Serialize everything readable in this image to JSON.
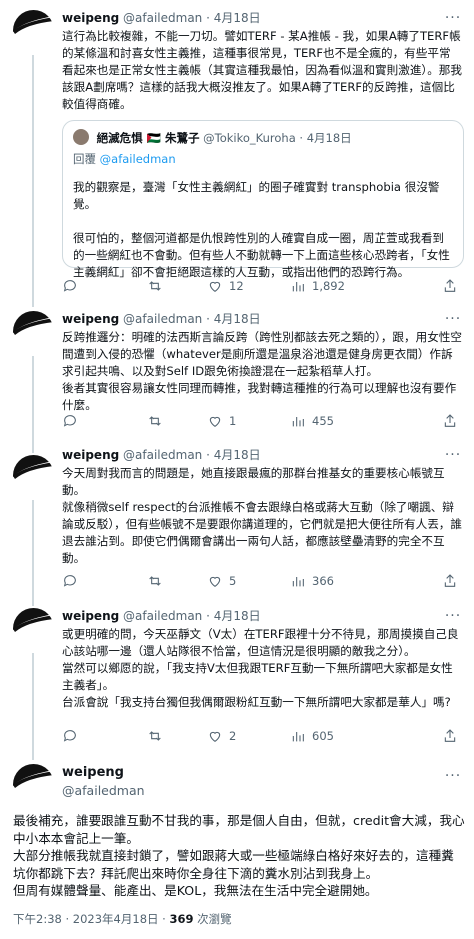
{
  "colors": {
    "text": "#0f1419",
    "secondary": "#536471",
    "border": "#cfd9de",
    "link": "#1d9bf0"
  },
  "author": {
    "name": "weipeng",
    "handle": "@afailedman"
  },
  "tweets": [
    {
      "date": "4月18日",
      "text": "這行為比較複雜，不能一刀切。譬如TERF - 某A推帳 - 我，如果A轉了TERF帳的某條溫和討喜女性主義推，這種事很常見，TERF也不是全瘋的，有些平常看起來也是正常女性主義帳（其實這種我最怕，因為看似溫和實則激進）。那我該跟A劃席嗎？這樣的話我大概沒推友了。如果A轉了TERF的反跨推，這個比較值得商確。",
      "quote": {
        "name": "絕滅危惧 🇵🇸 朱鷺子",
        "handle": "@Tokiko_Kuroha",
        "date": "4月18日",
        "reply_prefix": "回覆",
        "reply_to": "@afailedman",
        "text": "我的觀察是，臺灣「女性主義網紅」的圈子確實對 transphobia 很沒警覺。\n\n很可怕的，整個河道都是仇恨跨性別的人確實自成一圈，周芷萱或我看到的一些網紅也不會動。但有些人不動就轉一下上面這些核心恐跨者，「女性主義網紅」卻不會拒絕跟這樣的人互動，或指出他們的恐跨行為。"
      },
      "replies": "",
      "retweets": "",
      "likes": "12",
      "views": "1,892"
    },
    {
      "date": "4月18日",
      "text": "反跨推邏分：明確的法西斯言論反跨（跨性別都該去死之類的），跟，用女性空間遭到入侵的恐懼（whatever是廁所還是溫泉浴池還是健身房更衣間）作訴求引起共鳴、以及對Self ID跟免術換證混在一起紮稻草人打。\n後者其實很容易讓女性同理而轉推，我對轉這種推的行為可以理解也沒有要作什麼。",
      "replies": "",
      "retweets": "",
      "likes": "1",
      "views": "455"
    },
    {
      "date": "4月18日",
      "text": "今天周對我而言的問題是，她直接跟最瘋的那群台推基女的重要核心帳號互動。\n就像稍微self respect的台派推帳不會去跟綠白格或蔣大互動（除了嘲諷、辯論或反駁），但有些帳號不是要跟你講道理的，它們就是把大便往所有人丟，誰退去誰沾到。即使它們偶爾會講出一兩句人話，都應該壁壘清野的完全不互動。",
      "replies": "",
      "retweets": "",
      "likes": "5",
      "views": "366"
    },
    {
      "date": "4月18日",
      "text": "或更明確的問，今天巫靜文（V太）在TERF跟裡十分不待見，那周摸摸自己良心該站哪一邊（還人站隊很不恰當，但這情況是很明顯的敵我之分）。\n當然可以鄉愿的說，「我支持V太但我跟TERF互動一下無所謂吧大家都是女性主義者」。\n台派會說「我支持台獨但我偶爾跟粉紅互動一下無所謂吧大家都是華人」嗎?",
      "replies": "",
      "retweets": "",
      "likes": "2",
      "views": "605"
    }
  ],
  "main_tweet": {
    "text": "最後補充，誰要跟誰互動不甘我的事，那是個人自由，但就，credit會大減，我心中小本本會記上一筆。\n大部分推帳我就直接封鎖了，譬如跟蔣大或一些極端綠白格好來好去的，這種糞坑你都跳下去？拜託爬出來時你全身往下滴的糞水別沾到我身上。\n但周有媒體聲量、能產出、是KOL，我無法在生活中完全避開她。",
    "time": "下午2:38 · 2023年4月18日",
    "views_count": "369",
    "views_label": "次瀏覽"
  }
}
